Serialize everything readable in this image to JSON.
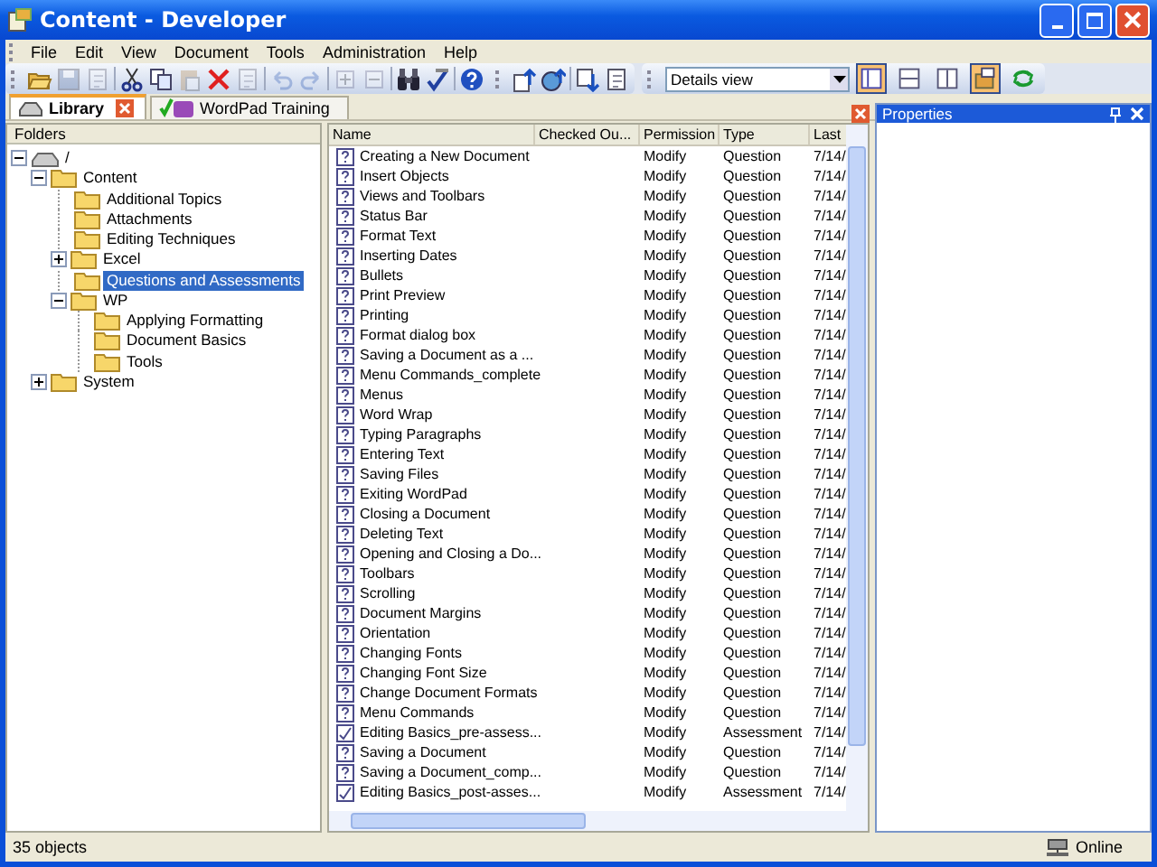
{
  "window": {
    "title": "Content - Developer"
  },
  "menu": [
    "File",
    "Edit",
    "View",
    "Document",
    "Tools",
    "Administration",
    "Help"
  ],
  "toolbar": [
    {
      "kind": "open",
      "disabled": false
    },
    {
      "kind": "save",
      "disabled": true
    },
    {
      "kind": "properties",
      "disabled": true
    },
    {
      "kind": "sep"
    },
    {
      "kind": "cut",
      "disabled": false
    },
    {
      "kind": "copy",
      "disabled": false
    },
    {
      "kind": "paste",
      "disabled": true
    },
    {
      "kind": "delete",
      "disabled": false
    },
    {
      "kind": "rename",
      "disabled": true
    },
    {
      "kind": "sep"
    },
    {
      "kind": "undo",
      "disabled": true
    },
    {
      "kind": "redo",
      "disabled": true
    },
    {
      "kind": "sep"
    },
    {
      "kind": "expand",
      "disabled": true
    },
    {
      "kind": "collapse",
      "disabled": true
    },
    {
      "kind": "sep"
    },
    {
      "kind": "find",
      "disabled": false
    },
    {
      "kind": "spell",
      "disabled": false
    },
    {
      "kind": "sep"
    },
    {
      "kind": "help",
      "disabled": false
    },
    {
      "kind": "grip"
    },
    {
      "kind": "import",
      "disabled": false
    },
    {
      "kind": "publish",
      "disabled": false
    },
    {
      "kind": "sep"
    },
    {
      "kind": "export",
      "disabled": false
    },
    {
      "kind": "page",
      "disabled": false
    }
  ],
  "view_select": {
    "value": "Details view"
  },
  "view_buttons": [
    {
      "kind": "details",
      "selected": true
    },
    {
      "kind": "split-h",
      "selected": false
    },
    {
      "kind": "split-v",
      "selected": false
    },
    {
      "kind": "properties",
      "selected": true
    },
    {
      "kind": "refresh",
      "selected": false
    }
  ],
  "tabs": [
    {
      "label": "Library",
      "selected": true
    },
    {
      "label": "WordPad Training",
      "selected": false
    }
  ],
  "folders": {
    "title": "Folders",
    "tree": [
      {
        "label": "/",
        "kind": "root",
        "expanded": true,
        "selected": false,
        "children": [
          {
            "label": "Content",
            "kind": "folder",
            "expanded": true,
            "selected": false,
            "children": [
              {
                "label": "Additional Topics",
                "kind": "folder",
                "selected": false
              },
              {
                "label": "Attachments",
                "kind": "folder",
                "selected": false
              },
              {
                "label": "Editing Techniques",
                "kind": "folder",
                "selected": false
              },
              {
                "label": "Excel",
                "kind": "folder",
                "expanded": false,
                "selected": false
              },
              {
                "label": "Questions and Assessments",
                "kind": "folder",
                "selected": true
              },
              {
                "label": "WP",
                "kind": "folder",
                "expanded": true,
                "selected": false,
                "children": [
                  {
                    "label": "Applying Formatting",
                    "kind": "folder",
                    "selected": false
                  },
                  {
                    "label": "Document Basics",
                    "kind": "folder",
                    "selected": false
                  },
                  {
                    "label": "Tools",
                    "kind": "folder",
                    "selected": false
                  }
                ]
              }
            ]
          },
          {
            "label": "System",
            "kind": "folder",
            "expanded": false,
            "selected": false
          }
        ]
      }
    ]
  },
  "list": {
    "columns": [
      "Name",
      "Checked Ou...",
      "Permission",
      "Type",
      "Last"
    ],
    "rows": [
      {
        "kind": "question",
        "name": "Creating a New Document",
        "permission": "Modify",
        "type": "Question",
        "date": "7/14/"
      },
      {
        "kind": "question",
        "name": "Insert Objects",
        "permission": "Modify",
        "type": "Question",
        "date": "7/14/"
      },
      {
        "kind": "question",
        "name": "Views and Toolbars",
        "permission": "Modify",
        "type": "Question",
        "date": "7/14/"
      },
      {
        "kind": "question",
        "name": "Status Bar",
        "permission": "Modify",
        "type": "Question",
        "date": "7/14/"
      },
      {
        "kind": "question",
        "name": "Format Text",
        "permission": "Modify",
        "type": "Question",
        "date": "7/14/"
      },
      {
        "kind": "question",
        "name": "Inserting Dates",
        "permission": "Modify",
        "type": "Question",
        "date": "7/14/"
      },
      {
        "kind": "question",
        "name": "Bullets",
        "permission": "Modify",
        "type": "Question",
        "date": "7/14/"
      },
      {
        "kind": "question",
        "name": "Print Preview",
        "permission": "Modify",
        "type": "Question",
        "date": "7/14/"
      },
      {
        "kind": "question",
        "name": "Printing",
        "permission": "Modify",
        "type": "Question",
        "date": "7/14/"
      },
      {
        "kind": "question",
        "name": "Format dialog box",
        "permission": "Modify",
        "type": "Question",
        "date": "7/14/"
      },
      {
        "kind": "question",
        "name": "Saving a Document as a ...",
        "permission": "Modify",
        "type": "Question",
        "date": "7/14/"
      },
      {
        "kind": "question",
        "name": "Menu Commands_complete",
        "permission": "Modify",
        "type": "Question",
        "date": "7/14/"
      },
      {
        "kind": "question",
        "name": "Menus",
        "permission": "Modify",
        "type": "Question",
        "date": "7/14/"
      },
      {
        "kind": "question",
        "name": "Word Wrap",
        "permission": "Modify",
        "type": "Question",
        "date": "7/14/"
      },
      {
        "kind": "question",
        "name": "Typing Paragraphs",
        "permission": "Modify",
        "type": "Question",
        "date": "7/14/"
      },
      {
        "kind": "question",
        "name": "Entering Text",
        "permission": "Modify",
        "type": "Question",
        "date": "7/14/"
      },
      {
        "kind": "question",
        "name": "Saving Files",
        "permission": "Modify",
        "type": "Question",
        "date": "7/14/"
      },
      {
        "kind": "question",
        "name": "Exiting WordPad",
        "permission": "Modify",
        "type": "Question",
        "date": "7/14/"
      },
      {
        "kind": "question",
        "name": "Closing a Document",
        "permission": "Modify",
        "type": "Question",
        "date": "7/14/"
      },
      {
        "kind": "question",
        "name": "Deleting Text",
        "permission": "Modify",
        "type": "Question",
        "date": "7/14/"
      },
      {
        "kind": "question",
        "name": "Opening and Closing a Do...",
        "permission": "Modify",
        "type": "Question",
        "date": "7/14/"
      },
      {
        "kind": "question",
        "name": "Toolbars",
        "permission": "Modify",
        "type": "Question",
        "date": "7/14/"
      },
      {
        "kind": "question",
        "name": "Scrolling",
        "permission": "Modify",
        "type": "Question",
        "date": "7/14/"
      },
      {
        "kind": "question",
        "name": "Document Margins",
        "permission": "Modify",
        "type": "Question",
        "date": "7/14/"
      },
      {
        "kind": "question",
        "name": "Orientation",
        "permission": "Modify",
        "type": "Question",
        "date": "7/14/"
      },
      {
        "kind": "question",
        "name": "Changing Fonts",
        "permission": "Modify",
        "type": "Question",
        "date": "7/14/"
      },
      {
        "kind": "question",
        "name": "Changing Font Size",
        "permission": "Modify",
        "type": "Question",
        "date": "7/14/"
      },
      {
        "kind": "question",
        "name": "Change Document Formats",
        "permission": "Modify",
        "type": "Question",
        "date": "7/14/"
      },
      {
        "kind": "question",
        "name": "Menu Commands",
        "permission": "Modify",
        "type": "Question",
        "date": "7/14/"
      },
      {
        "kind": "assessment",
        "name": "Editing Basics_pre-assess...",
        "permission": "Modify",
        "type": "Assessment",
        "date": "7/14/"
      },
      {
        "kind": "question",
        "name": "Saving a Document",
        "permission": "Modify",
        "type": "Question",
        "date": "7/14/"
      },
      {
        "kind": "question",
        "name": "Saving a Document_comp...",
        "permission": "Modify",
        "type": "Question",
        "date": "7/14/"
      },
      {
        "kind": "assessment",
        "name": "Editing Basics_post-asses...",
        "permission": "Modify",
        "type": "Assessment",
        "date": "7/14/"
      }
    ]
  },
  "properties": {
    "title": "Properties"
  },
  "status_bar": {
    "count": "35 objects",
    "connection": "Online"
  }
}
